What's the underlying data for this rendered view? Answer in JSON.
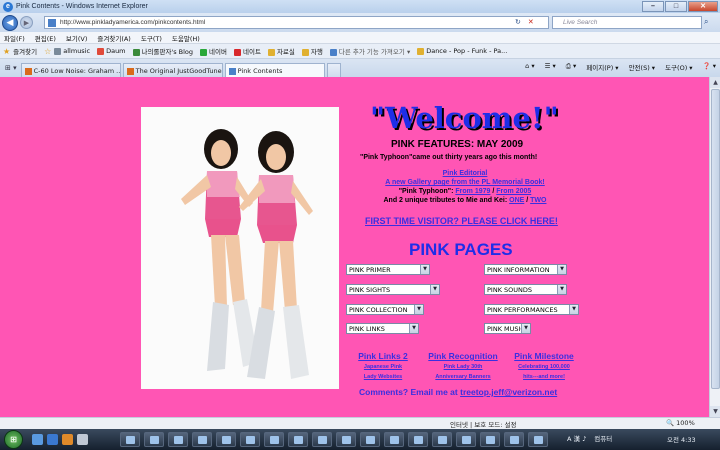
{
  "window": {
    "title": "Pink Contents - Windows Internet Explorer",
    "minimize": "–",
    "maximize": "□",
    "close": "✕"
  },
  "address": {
    "back": "◀",
    "forward": "▶",
    "url": "http://www.pinkladyamerica.com/pinkcontents.html",
    "refresh": "↻",
    "stop": "✕",
    "search_placeholder": "Live Search",
    "search_go": "⌕"
  },
  "menu": [
    "파일(F)",
    "편집(E)",
    "보기(V)",
    "즐겨찾기(A)",
    "도구(T)",
    "도움말(H)"
  ],
  "favorites": {
    "label": "즐겨찾기",
    "items": [
      "allmusic",
      "Daum",
      "나의롤판자's Blog",
      "네이버",
      "네이트",
      "자료실",
      "자행",
      "다른 추가 기능 가져오기 ▾",
      "Dance - Pop - Funk - Pa..."
    ]
  },
  "tabs": {
    "items": [
      "C-60 Low Noise: Graham ...",
      "The Original JustGoodTune...",
      "Pink Contents"
    ],
    "active_index": 2
  },
  "tools": [
    "페이지(P) ▾",
    "안전(S) ▾",
    "도구(O) ▾",
    "❓ ▾"
  ],
  "page": {
    "welcome": "\"Welcome!\"",
    "features": "PINK FEATURES: MAY 2009",
    "typhoon_note": "\"Pink Typhoon\"came out thirty years ago this month!",
    "editorial": "Pink Editorial",
    "gallery": "A new Gallery page from the PL Memorial Book!",
    "typhoon_label": "\"Pink Typhoon\":",
    "from_1979": "From 1979",
    "slash": "/",
    "from_2005": "From 2005",
    "tributes": "And 2 unique tributes to Mie and Kei:",
    "one": "ONE",
    "two": "TWO",
    "first_time": "FIRST TIME VISITOR? PLEASE CLICK HERE!",
    "pink_pages": "PINK PAGES",
    "selects": {
      "primer": "PINK PRIMER",
      "information": "PINK INFORMATION",
      "sights": "PINK SIGHTS",
      "sounds": "PINK SOUNDS",
      "collection": "PINK COLLECTION",
      "performances": "PINK PERFORMANCES",
      "links": "PINK LINKS",
      "music": "PINK MUSIC"
    },
    "links2": {
      "title": "Pink Links 2",
      "sub1": "Japanese Pink",
      "sub2": "Lady Websites"
    },
    "recognition": {
      "title": "Pink Recognition",
      "sub1": "Pink Lady 30th",
      "sub2": "Anniversary Banners"
    },
    "milestone": {
      "title": "Pink Milestone",
      "sub1": "Celebrating 100,000",
      "sub2": "hits---and more!"
    },
    "comments": "Comments? Email me at",
    "email": "treetop.jeff@verizon.net"
  },
  "status": {
    "zone": "인터넷 | 보호 모드: 설정",
    "zoom": "🔍 100%"
  },
  "taskbar": {
    "start": "⊞",
    "lang": "A 漢 ♪",
    "computer": "컴퓨터",
    "clock": "오전 4:33"
  }
}
